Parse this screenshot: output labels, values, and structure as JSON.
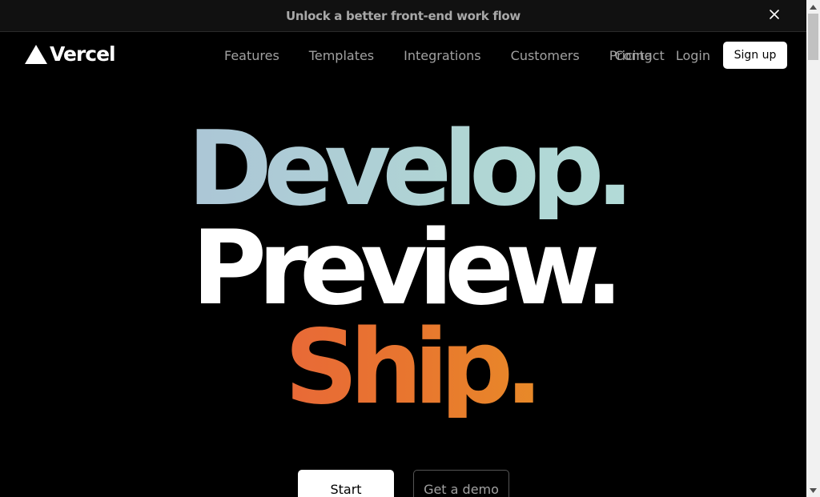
{
  "banner": {
    "text": "Unlock a better front-end work flow",
    "close_icon": "close-icon"
  },
  "brand": {
    "name": "Vercel",
    "logo_icon": "vercel-triangle-icon"
  },
  "nav": {
    "links": [
      {
        "label": "Features"
      },
      {
        "label": "Templates"
      },
      {
        "label": "Integrations"
      },
      {
        "label": "Customers"
      },
      {
        "label": "Pricing"
      }
    ],
    "contact": "Contact",
    "login": "Login",
    "signup": "Sign up"
  },
  "hero": {
    "line1": "Develop.",
    "line2": "Preview.",
    "line3": "Ship."
  },
  "cta": {
    "primary": "Start deploying",
    "secondary": "Get a demo"
  },
  "colors": {
    "background": "#000000",
    "banner_bg": "#111111",
    "develop_gradient": [
      "#a9bcd8",
      "#b6e0dc"
    ],
    "ship_gradient": [
      "#e64c4c",
      "#e6b21c"
    ]
  }
}
